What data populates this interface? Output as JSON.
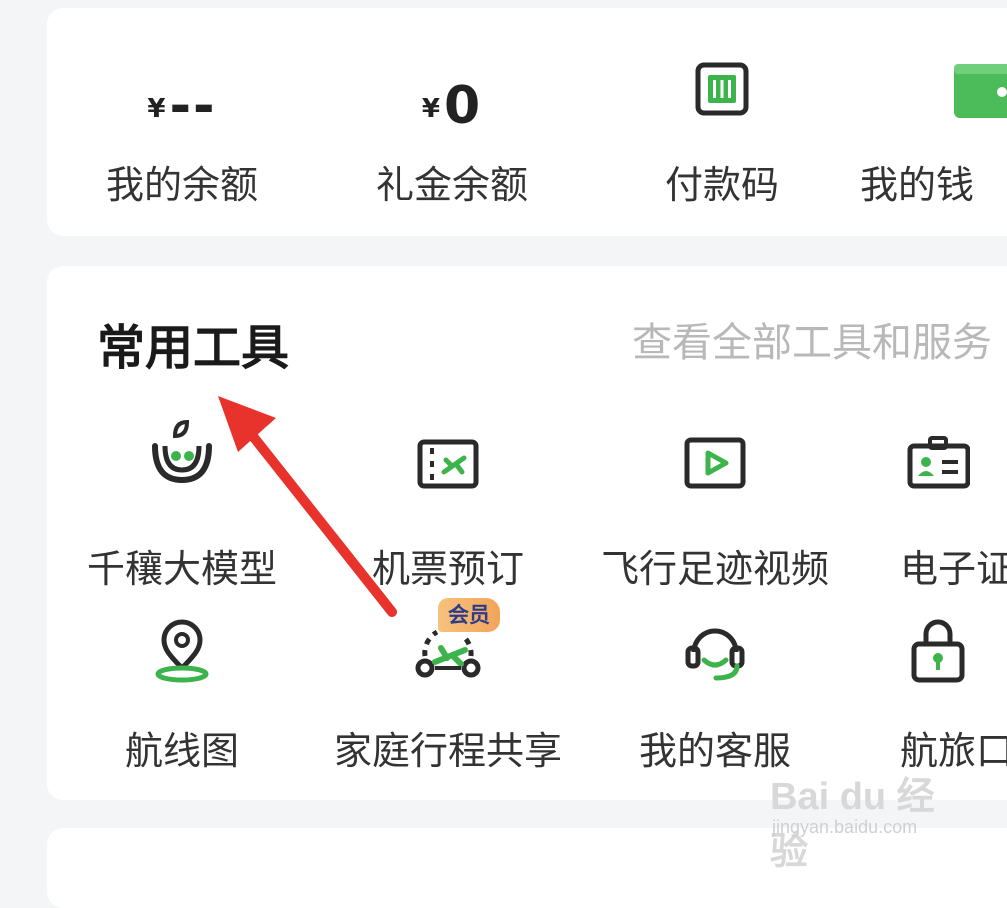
{
  "wallet": {
    "balance": {
      "currency": "¥",
      "amount": "--",
      "label": "我的余额"
    },
    "gift": {
      "currency": "¥",
      "amount": "0",
      "label": "礼金余额"
    },
    "paycode": {
      "label": "付款码",
      "icon": "payment-code-icon"
    },
    "wallet_partial": {
      "label": "我的钱",
      "icon": "wallet-icon"
    }
  },
  "tools": {
    "title": "常用工具",
    "view_all": "查看全部工具和服务",
    "items": [
      {
        "label": "千穰大模型",
        "icon": "ai-model-icon"
      },
      {
        "label": "机票预订",
        "icon": "ticket-icon"
      },
      {
        "label": "飞行足迹视频",
        "icon": "video-play-icon"
      },
      {
        "label": "电子证",
        "icon": "id-card-icon"
      },
      {
        "label": "航线图",
        "icon": "map-pin-icon"
      },
      {
        "label": "家庭行程共享",
        "icon": "family-flight-icon",
        "badge": "会员"
      },
      {
        "label": "我的客服",
        "icon": "headset-icon"
      },
      {
        "label": "航旅口",
        "icon": "lock-icon"
      }
    ]
  },
  "watermark": {
    "main": "Bai du 经验",
    "sub": "jingyan.baidu.com"
  },
  "colors": {
    "green": "#3cb44b",
    "dark": "#2a2a2a",
    "arrow": "#e8322c",
    "badge": "#f4b06a"
  }
}
